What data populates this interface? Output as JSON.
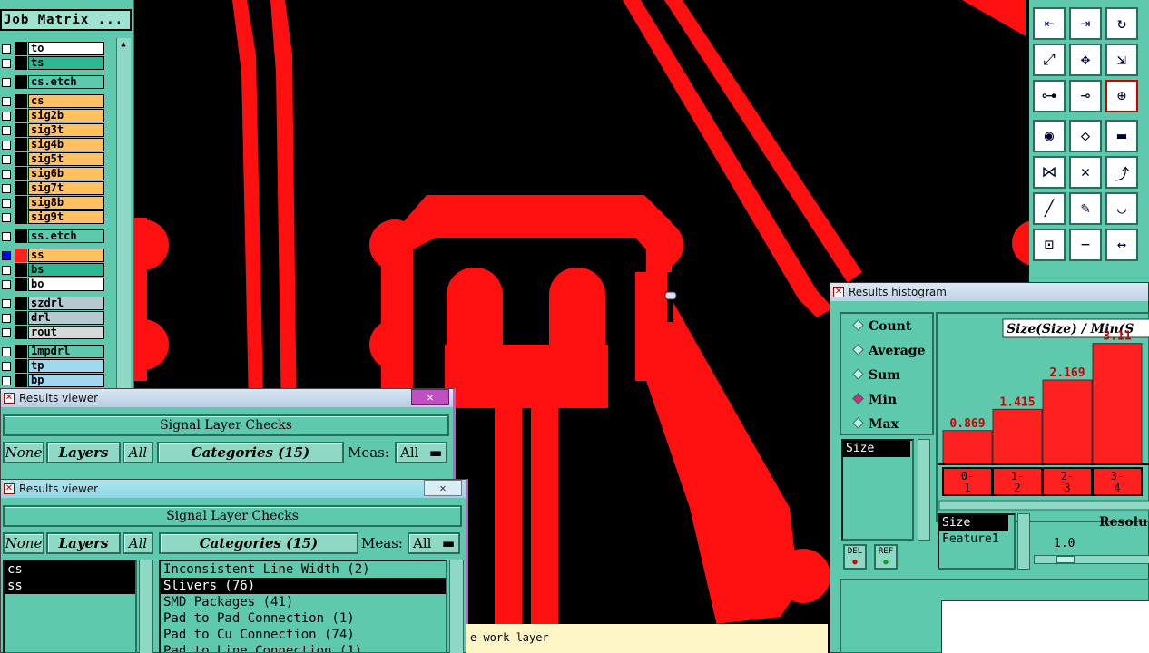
{
  "layers_panel": {
    "title": "Job Matrix ...",
    "layers": [
      {
        "name": "to",
        "bg": "#ffffff"
      },
      {
        "name": "ts",
        "bg": "#2db894"
      },
      {
        "name": "cs.etch",
        "bg": "#5fc9ad"
      },
      {
        "name": "cs",
        "bg": "#ffc060"
      },
      {
        "name": "sig2b",
        "bg": "#ffc060"
      },
      {
        "name": "sig3t",
        "bg": "#ffc060"
      },
      {
        "name": "sig4b",
        "bg": "#ffc060"
      },
      {
        "name": "sig5t",
        "bg": "#ffc060"
      },
      {
        "name": "sig6b",
        "bg": "#ffc060"
      },
      {
        "name": "sig7t",
        "bg": "#ffc060"
      },
      {
        "name": "sig8b",
        "bg": "#ffc060"
      },
      {
        "name": "sig9t",
        "bg": "#ffc060"
      },
      {
        "name": "ss.etch",
        "bg": "#5fc9ad"
      },
      {
        "name": "ss",
        "bg": "#ffc060"
      },
      {
        "name": "bs",
        "bg": "#2db894"
      },
      {
        "name": "bo",
        "bg": "#ffffff"
      },
      {
        "name": "szdrl",
        "bg": "#b8c8d0"
      },
      {
        "name": "drl",
        "bg": "#b8c8d0"
      },
      {
        "name": "rout",
        "bg": "#d8d8d8"
      },
      {
        "name": "1mpdrl",
        "bg": "#5fc9ad"
      },
      {
        "name": "tp",
        "bg": "#9fd8f0"
      },
      {
        "name": "bp",
        "bg": "#9fd8f0"
      }
    ]
  },
  "viewer_back": {
    "title": "Results viewer",
    "header": "Signal Layer Checks",
    "none_label": "None",
    "layers_label": "Layers",
    "all_label": "All",
    "categories_label": "Categories (15)",
    "meas_label": "Meas:",
    "meas_value": "All"
  },
  "viewer_front": {
    "title": "Results viewer",
    "header": "Signal Layer Checks",
    "none_label": "None",
    "layers_label": "Layers",
    "all_label": "All",
    "categories_label": "Categories (15)",
    "meas_label": "Meas:",
    "meas_value": "All",
    "layers": [
      "cs",
      "ss"
    ],
    "categories": [
      "Inconsistent Line Width (2)",
      "Slivers (76)",
      "SMD Packages (41)",
      "Pad to Pad Connection (1)",
      "Pad to Cu Connection (74)",
      "Pad to Line Connection (1)"
    ],
    "selected_category": 1
  },
  "histogram": {
    "title": "Results histogram",
    "modes": [
      "Count",
      "Average",
      "Sum",
      "Min",
      "Max"
    ],
    "selected_mode": 3,
    "size_item": "Size",
    "del_label": "DEL",
    "ref_label": "REF",
    "chart_title": "Size(Size) / Min(S",
    "attr_items": [
      "Size",
      "Feature1"
    ],
    "resolution_label": "Resolu",
    "resolution_value": "1.0"
  },
  "chart_data": {
    "type": "bar",
    "title": "Size(Size) / Min(S",
    "categories": [
      "0-\n1",
      "1-\n2",
      "2-\n3",
      "3-\n4"
    ],
    "values": [
      0.869,
      1.415,
      2.169,
      3.11
    ],
    "labels": [
      "0.869",
      "1.415",
      "2.169",
      "3.11"
    ],
    "bar_color": "#ff2020"
  },
  "status": {
    "text": "e work layer"
  }
}
